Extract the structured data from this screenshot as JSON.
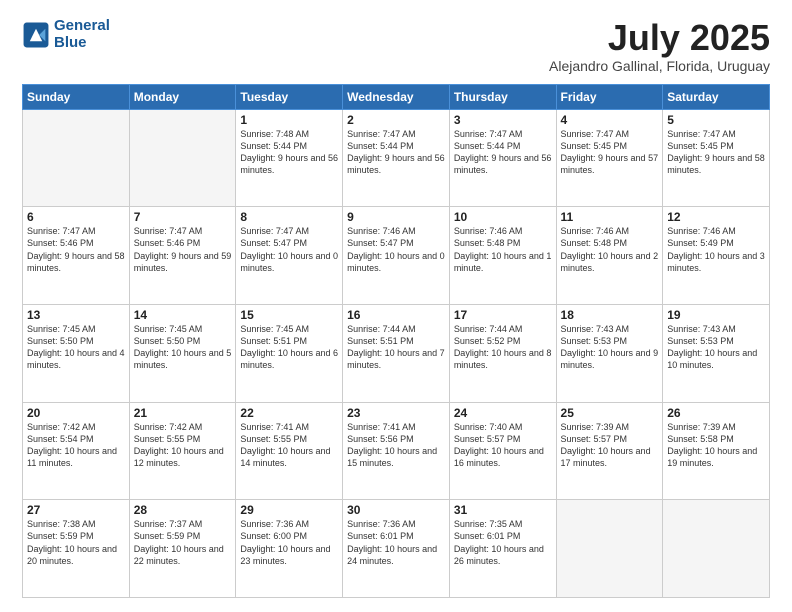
{
  "header": {
    "logo_line1": "General",
    "logo_line2": "Blue",
    "month": "July 2025",
    "location": "Alejandro Gallinal, Florida, Uruguay"
  },
  "days_of_week": [
    "Sunday",
    "Monday",
    "Tuesday",
    "Wednesday",
    "Thursday",
    "Friday",
    "Saturday"
  ],
  "weeks": [
    [
      {
        "day": "",
        "info": ""
      },
      {
        "day": "",
        "info": ""
      },
      {
        "day": "1",
        "info": "Sunrise: 7:48 AM\nSunset: 5:44 PM\nDaylight: 9 hours and 56 minutes."
      },
      {
        "day": "2",
        "info": "Sunrise: 7:47 AM\nSunset: 5:44 PM\nDaylight: 9 hours and 56 minutes."
      },
      {
        "day": "3",
        "info": "Sunrise: 7:47 AM\nSunset: 5:44 PM\nDaylight: 9 hours and 56 minutes."
      },
      {
        "day": "4",
        "info": "Sunrise: 7:47 AM\nSunset: 5:45 PM\nDaylight: 9 hours and 57 minutes."
      },
      {
        "day": "5",
        "info": "Sunrise: 7:47 AM\nSunset: 5:45 PM\nDaylight: 9 hours and 58 minutes."
      }
    ],
    [
      {
        "day": "6",
        "info": "Sunrise: 7:47 AM\nSunset: 5:46 PM\nDaylight: 9 hours and 58 minutes."
      },
      {
        "day": "7",
        "info": "Sunrise: 7:47 AM\nSunset: 5:46 PM\nDaylight: 9 hours and 59 minutes."
      },
      {
        "day": "8",
        "info": "Sunrise: 7:47 AM\nSunset: 5:47 PM\nDaylight: 10 hours and 0 minutes."
      },
      {
        "day": "9",
        "info": "Sunrise: 7:46 AM\nSunset: 5:47 PM\nDaylight: 10 hours and 0 minutes."
      },
      {
        "day": "10",
        "info": "Sunrise: 7:46 AM\nSunset: 5:48 PM\nDaylight: 10 hours and 1 minute."
      },
      {
        "day": "11",
        "info": "Sunrise: 7:46 AM\nSunset: 5:48 PM\nDaylight: 10 hours and 2 minutes."
      },
      {
        "day": "12",
        "info": "Sunrise: 7:46 AM\nSunset: 5:49 PM\nDaylight: 10 hours and 3 minutes."
      }
    ],
    [
      {
        "day": "13",
        "info": "Sunrise: 7:45 AM\nSunset: 5:50 PM\nDaylight: 10 hours and 4 minutes."
      },
      {
        "day": "14",
        "info": "Sunrise: 7:45 AM\nSunset: 5:50 PM\nDaylight: 10 hours and 5 minutes."
      },
      {
        "day": "15",
        "info": "Sunrise: 7:45 AM\nSunset: 5:51 PM\nDaylight: 10 hours and 6 minutes."
      },
      {
        "day": "16",
        "info": "Sunrise: 7:44 AM\nSunset: 5:51 PM\nDaylight: 10 hours and 7 minutes."
      },
      {
        "day": "17",
        "info": "Sunrise: 7:44 AM\nSunset: 5:52 PM\nDaylight: 10 hours and 8 minutes."
      },
      {
        "day": "18",
        "info": "Sunrise: 7:43 AM\nSunset: 5:53 PM\nDaylight: 10 hours and 9 minutes."
      },
      {
        "day": "19",
        "info": "Sunrise: 7:43 AM\nSunset: 5:53 PM\nDaylight: 10 hours and 10 minutes."
      }
    ],
    [
      {
        "day": "20",
        "info": "Sunrise: 7:42 AM\nSunset: 5:54 PM\nDaylight: 10 hours and 11 minutes."
      },
      {
        "day": "21",
        "info": "Sunrise: 7:42 AM\nSunset: 5:55 PM\nDaylight: 10 hours and 12 minutes."
      },
      {
        "day": "22",
        "info": "Sunrise: 7:41 AM\nSunset: 5:55 PM\nDaylight: 10 hours and 14 minutes."
      },
      {
        "day": "23",
        "info": "Sunrise: 7:41 AM\nSunset: 5:56 PM\nDaylight: 10 hours and 15 minutes."
      },
      {
        "day": "24",
        "info": "Sunrise: 7:40 AM\nSunset: 5:57 PM\nDaylight: 10 hours and 16 minutes."
      },
      {
        "day": "25",
        "info": "Sunrise: 7:39 AM\nSunset: 5:57 PM\nDaylight: 10 hours and 17 minutes."
      },
      {
        "day": "26",
        "info": "Sunrise: 7:39 AM\nSunset: 5:58 PM\nDaylight: 10 hours and 19 minutes."
      }
    ],
    [
      {
        "day": "27",
        "info": "Sunrise: 7:38 AM\nSunset: 5:59 PM\nDaylight: 10 hours and 20 minutes."
      },
      {
        "day": "28",
        "info": "Sunrise: 7:37 AM\nSunset: 5:59 PM\nDaylight: 10 hours and 22 minutes."
      },
      {
        "day": "29",
        "info": "Sunrise: 7:36 AM\nSunset: 6:00 PM\nDaylight: 10 hours and 23 minutes."
      },
      {
        "day": "30",
        "info": "Sunrise: 7:36 AM\nSunset: 6:01 PM\nDaylight: 10 hours and 24 minutes."
      },
      {
        "day": "31",
        "info": "Sunrise: 7:35 AM\nSunset: 6:01 PM\nDaylight: 10 hours and 26 minutes."
      },
      {
        "day": "",
        "info": ""
      },
      {
        "day": "",
        "info": ""
      }
    ]
  ]
}
